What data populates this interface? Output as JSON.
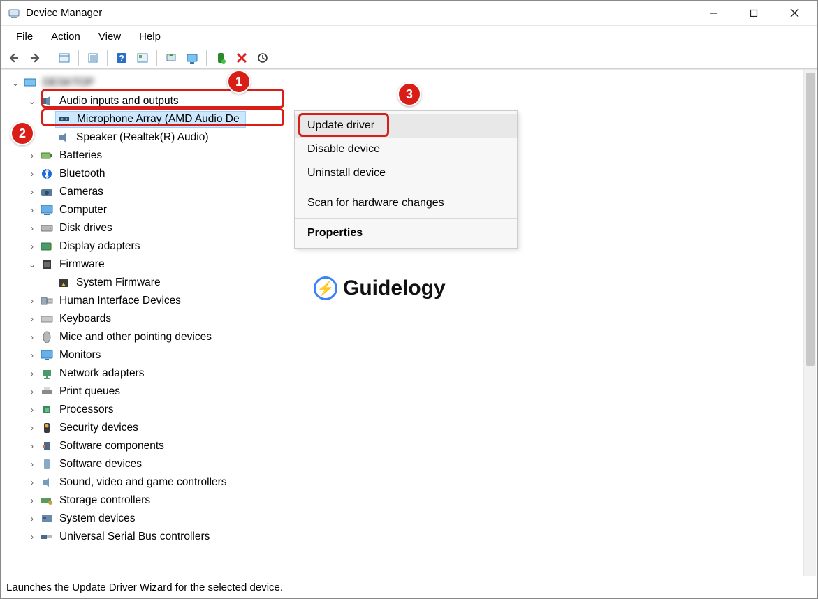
{
  "window": {
    "title": "Device Manager"
  },
  "menubar": [
    "File",
    "Action",
    "View",
    "Help"
  ],
  "toolbar_icons": [
    "back-icon",
    "forward-icon",
    "sep",
    "show-all-icon",
    "sep",
    "properties-icon",
    "sep",
    "help-icon",
    "details-icon",
    "sep",
    "update-driver-icon",
    "monitor-icon",
    "sep",
    "enable-icon",
    "disable-icon",
    "scan-icon"
  ],
  "tree": {
    "root": {
      "label": ""
    },
    "audio": {
      "label": "Audio inputs and outputs",
      "children": [
        {
          "label": "Microphone Array (AMD Audio De",
          "selected": true
        },
        {
          "label": "Speaker (Realtek(R) Audio)"
        }
      ]
    },
    "categories": [
      {
        "label": "Batteries",
        "icon": "battery"
      },
      {
        "label": "Bluetooth",
        "icon": "bluetooth"
      },
      {
        "label": "Cameras",
        "icon": "camera"
      },
      {
        "label": "Computer",
        "icon": "computer"
      },
      {
        "label": "Disk drives",
        "icon": "disk"
      },
      {
        "label": "Display adapters",
        "icon": "display"
      }
    ],
    "firmware": {
      "label": "Firmware",
      "children": [
        {
          "label": "System Firmware"
        }
      ]
    },
    "categories2": [
      {
        "label": "Human Interface Devices",
        "icon": "hid"
      },
      {
        "label": "Keyboards",
        "icon": "keyboard"
      },
      {
        "label": "Mice and other pointing devices",
        "icon": "mouse"
      },
      {
        "label": "Monitors",
        "icon": "monitor"
      },
      {
        "label": "Network adapters",
        "icon": "network"
      },
      {
        "label": "Print queues",
        "icon": "printer"
      },
      {
        "label": "Processors",
        "icon": "cpu"
      },
      {
        "label": "Security devices",
        "icon": "security"
      },
      {
        "label": "Software components",
        "icon": "swcomp"
      },
      {
        "label": "Software devices",
        "icon": "swdev"
      },
      {
        "label": "Sound, video and game controllers",
        "icon": "sound"
      },
      {
        "label": "Storage controllers",
        "icon": "storage"
      },
      {
        "label": "System devices",
        "icon": "system"
      },
      {
        "label": "Universal Serial Bus controllers",
        "icon": "usb"
      }
    ]
  },
  "context_menu": {
    "items": [
      {
        "label": "Update driver",
        "hovered": true
      },
      {
        "label": "Disable device"
      },
      {
        "label": "Uninstall device"
      },
      {
        "sep": true
      },
      {
        "label": "Scan for hardware changes"
      },
      {
        "sep": true
      },
      {
        "label": "Properties",
        "bold": true
      }
    ]
  },
  "statusbar": "Launches the Update Driver Wizard for the selected device.",
  "annotations": {
    "1": "1",
    "2": "2",
    "3": "3"
  },
  "watermark": "Guidelogy"
}
